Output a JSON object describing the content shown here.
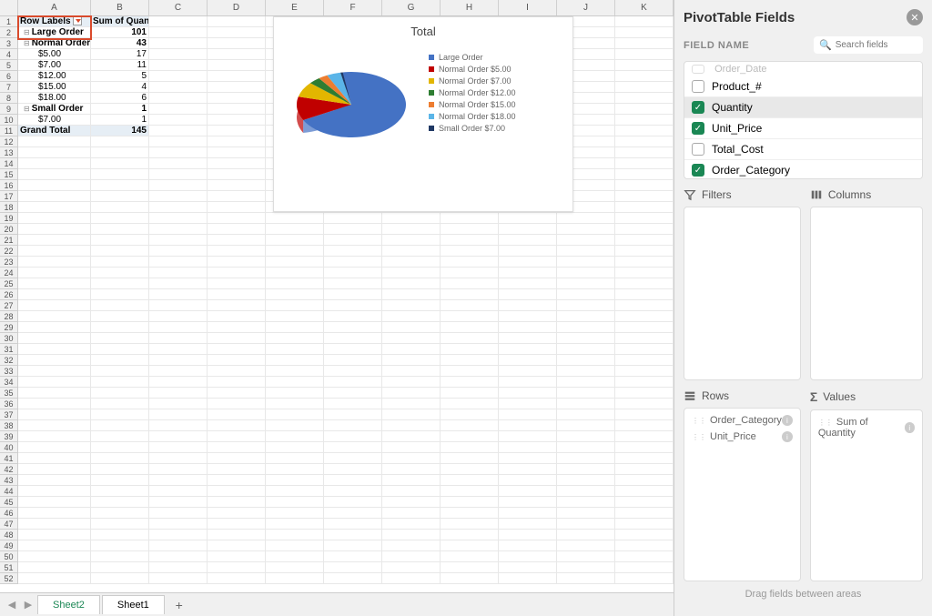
{
  "columns": [
    "A",
    "B",
    "C",
    "D",
    "E",
    "F",
    "G",
    "H",
    "I",
    "J",
    "K"
  ],
  "pivot": {
    "header_a": "Row Labels",
    "header_b": "Sum of Quantity",
    "rows": [
      {
        "label": "Large Order",
        "value": "101",
        "bold": true,
        "expand": true
      },
      {
        "label": "Normal Order",
        "value": "43",
        "bold": true,
        "expand": true
      },
      {
        "label": "$5.00",
        "value": "17",
        "indent": true
      },
      {
        "label": "$7.00",
        "value": "11",
        "indent": true
      },
      {
        "label": "$12.00",
        "value": "5",
        "indent": true
      },
      {
        "label": "$15.00",
        "value": "4",
        "indent": true
      },
      {
        "label": "$18.00",
        "value": "6",
        "indent": true
      },
      {
        "label": "Small Order",
        "value": "1",
        "bold": true,
        "expand": true
      },
      {
        "label": "$7.00",
        "value": "1",
        "indent": true
      }
    ],
    "total_label": "Grand Total",
    "total_value": "145"
  },
  "chart_data": {
    "type": "pie",
    "title": "Total",
    "series": [
      {
        "name": "Large Order",
        "value": 101,
        "color": "#4472c4"
      },
      {
        "name": "Normal Order $5.00",
        "value": 17,
        "color": "#c00000"
      },
      {
        "name": "Normal Order $7.00",
        "value": 11,
        "color": "#e2b600"
      },
      {
        "name": "Normal Order $12.00",
        "value": 5,
        "color": "#2e7d32"
      },
      {
        "name": "Normal Order $15.00",
        "value": 4,
        "color": "#ed7d31"
      },
      {
        "name": "Normal Order $18.00",
        "value": 6,
        "color": "#5bb5e8"
      },
      {
        "name": "Small Order $7.00",
        "value": 1,
        "color": "#1f3864"
      }
    ]
  },
  "tabs": {
    "active": "Sheet2",
    "other": "Sheet1"
  },
  "panel": {
    "title": "PivotTable Fields",
    "field_name_label": "FIELD NAME",
    "search_placeholder": "Search fields",
    "faded_field": "Order_Date",
    "fields": [
      {
        "name": "Product_#",
        "checked": false
      },
      {
        "name": "Quantity",
        "checked": true,
        "selected": true
      },
      {
        "name": "Unit_Price",
        "checked": true
      },
      {
        "name": "Total_Cost",
        "checked": false
      },
      {
        "name": "Order_Category",
        "checked": true
      }
    ],
    "areas": {
      "filters": {
        "label": "Filters",
        "items": []
      },
      "columns": {
        "label": "Columns",
        "items": []
      },
      "rows": {
        "label": "Rows",
        "items": [
          "Order_Category",
          "Unit_Price"
        ]
      },
      "values": {
        "label": "Values",
        "items": [
          "Sum of Quantity"
        ]
      }
    },
    "drag_hint": "Drag fields between areas"
  }
}
